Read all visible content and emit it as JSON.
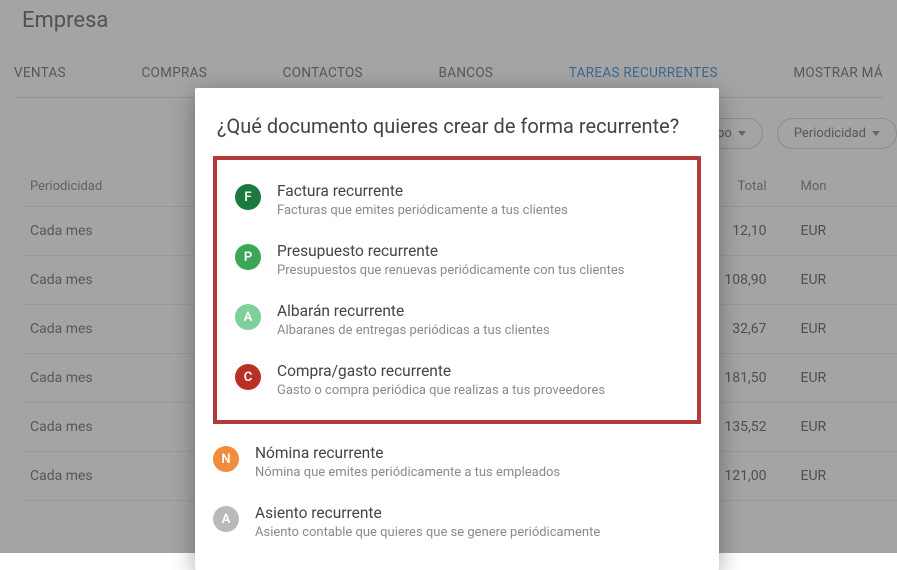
{
  "header": {
    "title": "Empresa"
  },
  "tabs": {
    "items": [
      "VENTAS",
      "COMPRAS",
      "CONTACTOS",
      "BANCOS",
      "TAREAS RECURRENTES",
      "MOSTRAR MÁ"
    ],
    "activeIndex": 4
  },
  "filters": {
    "tipo_label": "Tipo",
    "periodicidad_label": "Periodicidad"
  },
  "table": {
    "headers": {
      "periodicidad": "Periodicidad",
      "total": "Total",
      "moneda": "Mon"
    },
    "rows": [
      {
        "periodicidad": "Cada mes",
        "total": "12,10",
        "moneda": "EUR"
      },
      {
        "periodicidad": "Cada mes",
        "total": "108,90",
        "moneda": "EUR"
      },
      {
        "periodicidad": "Cada mes",
        "total": "32,67",
        "moneda": "EUR"
      },
      {
        "periodicidad": "Cada mes",
        "total": "181,50",
        "moneda": "EUR"
      },
      {
        "periodicidad": "Cada mes",
        "total": "135,52",
        "moneda": "EUR"
      },
      {
        "periodicidad": "Cada mes",
        "total": "121,00",
        "moneda": "EUR"
      }
    ]
  },
  "modal": {
    "title": "¿Qué documento quieres crear de forma recurrente?",
    "options": [
      {
        "letter": "F",
        "avatar_class": "av-F",
        "label": "Factura recurrente",
        "desc": "Facturas que emites periódicamente a tus clientes"
      },
      {
        "letter": "P",
        "avatar_class": "av-P",
        "label": "Presupuesto recurrente",
        "desc": "Presupuestos que renuevas periódicamente con tus clientes"
      },
      {
        "letter": "A",
        "avatar_class": "av-A",
        "label": "Albarán recurrente",
        "desc": "Albaranes de entregas periódicas a tus clientes"
      },
      {
        "letter": "C",
        "avatar_class": "av-C",
        "label": "Compra/gasto recurrente",
        "desc": "Gasto o compra periódica que realizas a tus proveedores"
      },
      {
        "letter": "N",
        "avatar_class": "av-N",
        "label": "Nómina recurrente",
        "desc": "Nómina que emites periódicamente a tus empleados"
      },
      {
        "letter": "A",
        "avatar_class": "av-As",
        "label": "Asiento recurrente",
        "desc": "Asiento contable que quieres que se genere periódicamente"
      }
    ],
    "highlight_count": 4
  }
}
